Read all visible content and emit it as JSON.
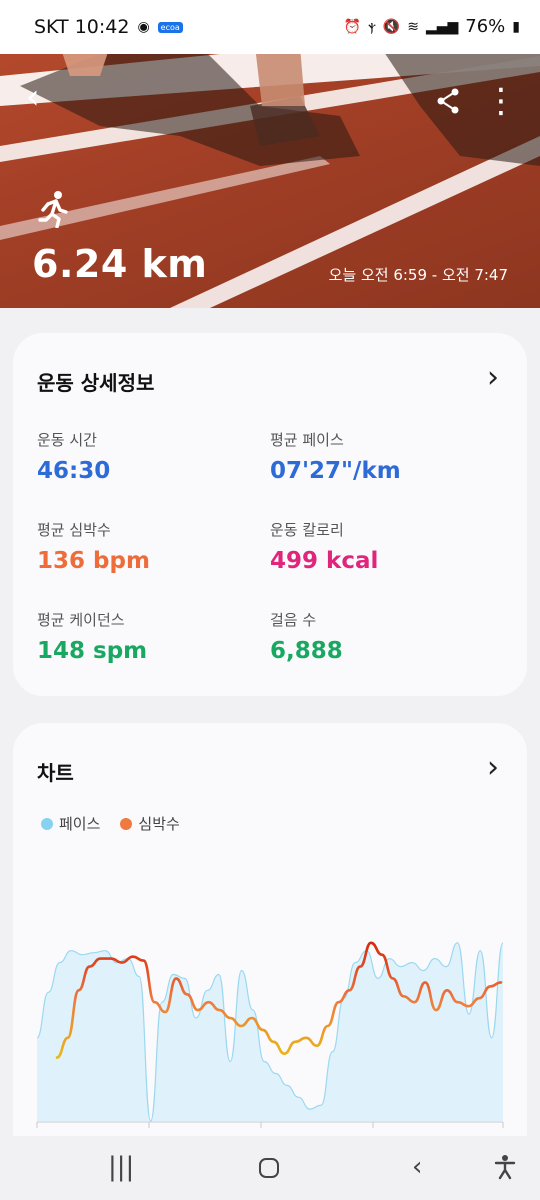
{
  "status_bar": {
    "carrier_time": "SKT 10:42",
    "badge": "ecoa",
    "battery": "76%"
  },
  "hero": {
    "distance": "6.24 km",
    "time_range": "오늘 오전 6:59 - 오전 7:47",
    "icons": [
      "back-icon",
      "share-icon",
      "more-icon",
      "running-icon"
    ]
  },
  "details": {
    "title": "운동 상세정보",
    "metrics": [
      {
        "label": "운동 시간",
        "value": "46:30",
        "color": "#2d6bd6"
      },
      {
        "label": "평균 페이스",
        "value": "07'27\"/km",
        "color": "#2d6bd6"
      },
      {
        "label": "평균 심박수",
        "value": "136 bpm",
        "color": "#ee6b3a"
      },
      {
        "label": "운동 칼로리",
        "value": "499 kcal",
        "color": "#e0257c"
      },
      {
        "label": "평균 케이던스",
        "value": "148 spm",
        "color": "#19a862"
      },
      {
        "label": "걸음 수",
        "value": "6,888",
        "color": "#19a862"
      }
    ]
  },
  "chart": {
    "title": "차트",
    "legend": [
      {
        "name": "페이스",
        "color": "#86d2f0"
      },
      {
        "name": "심박수",
        "color": "#ee7a3f"
      }
    ]
  },
  "chart_data": {
    "type": "area",
    "series": [
      {
        "name": "페이스",
        "values": [
          0.42,
          0.65,
          0.8,
          0.86,
          0.84,
          0.85,
          0.86,
          0.8,
          0.82,
          0.73,
          0.0,
          0.6,
          0.74,
          0.72,
          0.52,
          0.66,
          0.74,
          0.3,
          0.76,
          0.56,
          0.3,
          0.24,
          0.18,
          0.12,
          0.06,
          0.08,
          0.35,
          0.62,
          0.8,
          0.86,
          0.72,
          0.82,
          0.78,
          0.8,
          0.76,
          0.82,
          0.78,
          0.9,
          0.54,
          0.86,
          0.42,
          0.9
        ]
      },
      {
        "name": "심박수",
        "values": [
          0.32,
          0.42,
          0.66,
          0.78,
          0.82,
          0.82,
          0.8,
          0.83,
          0.81,
          0.6,
          0.55,
          0.72,
          0.64,
          0.56,
          0.6,
          0.56,
          0.52,
          0.48,
          0.52,
          0.46,
          0.4,
          0.34,
          0.4,
          0.42,
          0.38,
          0.48,
          0.6,
          0.66,
          0.78,
          0.9,
          0.84,
          0.72,
          0.63,
          0.6,
          0.7,
          0.56,
          0.66,
          0.6,
          0.58,
          0.62,
          0.68,
          0.7
        ]
      }
    ],
    "ylim": [
      0,
      1
    ]
  }
}
